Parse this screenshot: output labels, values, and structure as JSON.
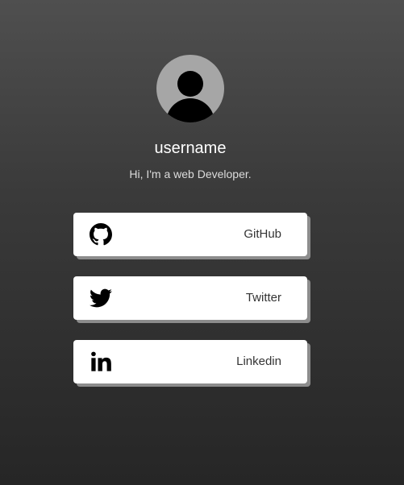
{
  "profile": {
    "username": "username",
    "bio": "Hi, I'm a web Developer."
  },
  "links": [
    {
      "label": "GitHub",
      "icon": "github-icon"
    },
    {
      "label": "Twitter",
      "icon": "twitter-icon"
    },
    {
      "label": "Linkedin",
      "icon": "linkedin-icon"
    }
  ],
  "colors": {
    "background_top": "#4f4f4f",
    "background_bottom": "#262626",
    "card": "#ffffff",
    "card_shadow": "#8c8c8c",
    "avatar_bg": "#a6a6a6"
  }
}
